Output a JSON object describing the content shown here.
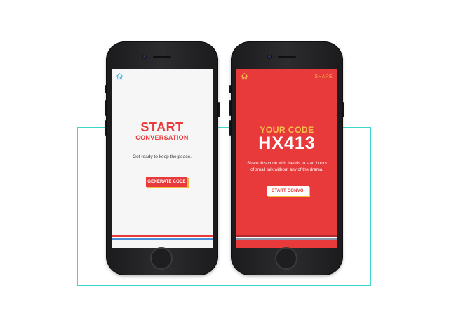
{
  "left_screen": {
    "title_line1": "START",
    "title_line2": "CONVERSATION",
    "subtitle": "Get ready to keep the peace.",
    "button_label": "GENERATE CODE",
    "home_icon": "home-icon"
  },
  "right_screen": {
    "share_label": "SHARE",
    "code_title": "YOUR CODE",
    "code_value": "HX413",
    "description": "Share this code with friends to start hours of small talk without any of the drama.",
    "button_label": "START CONVO",
    "home_icon": "home-icon"
  },
  "colors": {
    "brand_red": "#e8393b",
    "accent_yellow": "#f3b93e",
    "teal_frame": "#3fd6cc",
    "stripe_blue": "#4b8fd6"
  }
}
